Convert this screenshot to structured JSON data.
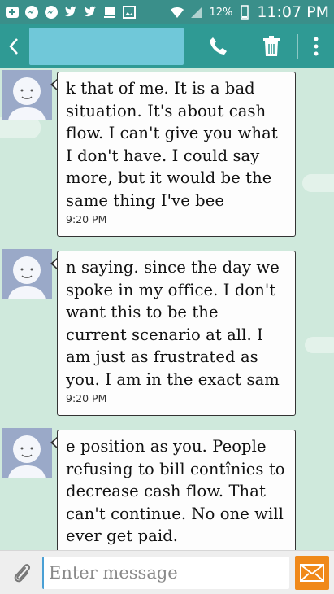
{
  "statusbar": {
    "battery_percent": "12%",
    "time": "11:07 PM",
    "icons": [
      "add-icon",
      "messenger-icon",
      "messenger-icon",
      "twitter-icon",
      "twitter-icon",
      "calendar-icon",
      "gallery-icon",
      "wifi-icon",
      "signal-icon",
      "battery-icon"
    ]
  },
  "header": {
    "contact_name": "",
    "actions": [
      "call-icon",
      "delete-icon",
      "more-icon"
    ]
  },
  "messages": [
    {
      "text": "k that of me. It is a bad\nsituation.  It's about cash\nflow. I can't give you what\nI don't have. I could say\nmore, but it would be the\nsame thing I've bee",
      "time": "9:20 PM"
    },
    {
      "text": "n saying. since the day we\nspoke in my office. I don't\nwant this to be the\ncurrent scenario at all. I\nam just as frustrated as\nyou. I am in the exact sam",
      "time": "9:20 PM"
    },
    {
      "text": "e position as you. People\nrefusing to bill contînies to\ndecrease cash flow. That\ncan't continue. No one will\never get paid.",
      "time": ""
    }
  ],
  "composer": {
    "placeholder": "Enter message"
  },
  "colors": {
    "statusbar": "#3a8f8a",
    "appbar": "#2f9a94",
    "background": "#cfe9dc",
    "send": "#f0891a"
  }
}
